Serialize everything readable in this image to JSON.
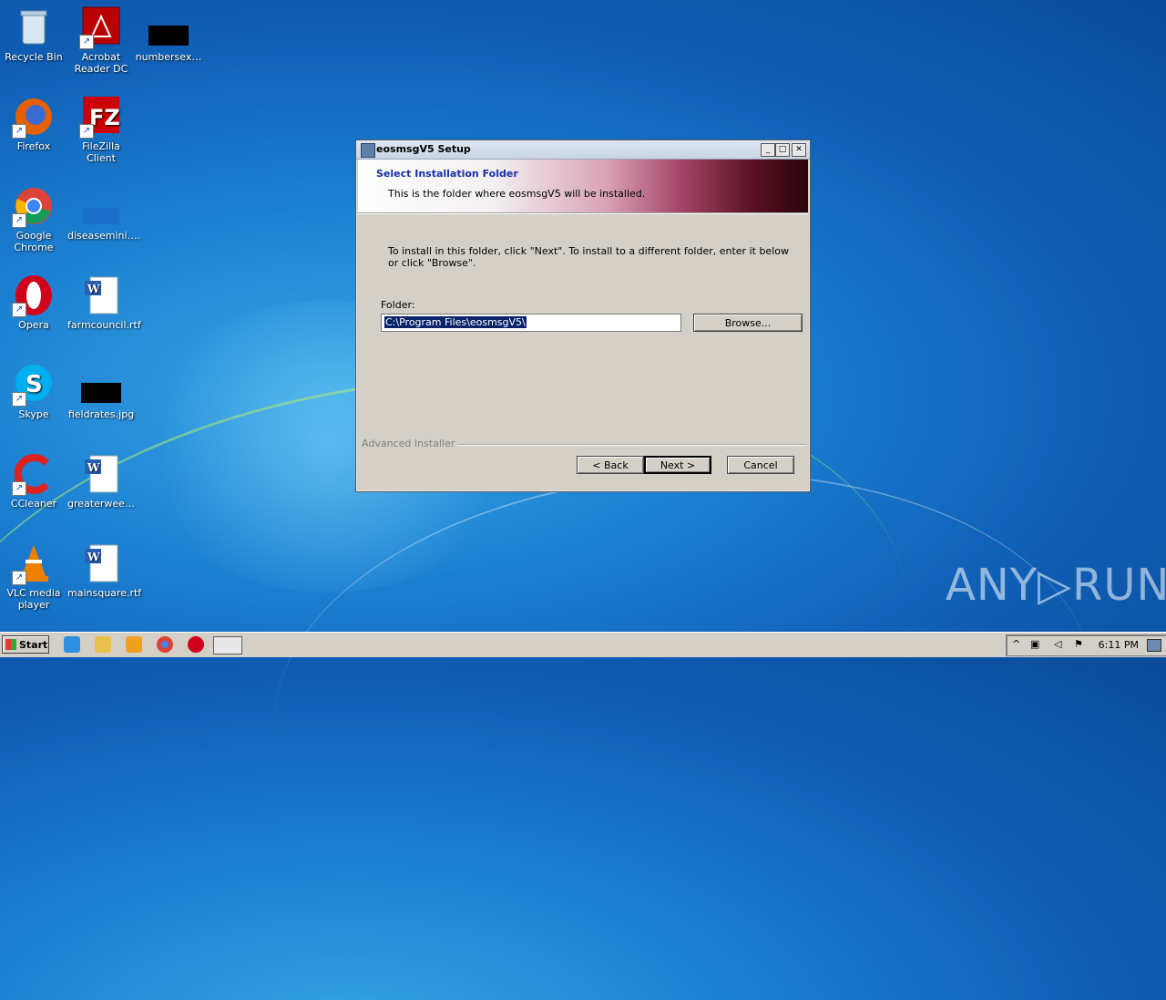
{
  "desktop": {
    "icons": [
      {
        "label": "Recycle Bin",
        "icon": "recycle-bin-icon"
      },
      {
        "label": "Acrobat Reader DC",
        "icon": "acrobat-icon"
      },
      {
        "label": "numbersex…",
        "icon": "file-icon"
      },
      {
        "label": "Firefox",
        "icon": "firefox-icon"
      },
      {
        "label": "FileZilla Client",
        "icon": "filezilla-icon"
      },
      {
        "label": "Google Chrome",
        "icon": "chrome-icon"
      },
      {
        "label": "diseasemini….",
        "icon": "file-icon"
      },
      {
        "label": "Opera",
        "icon": "opera-icon"
      },
      {
        "label": "farmcouncil.rtf",
        "icon": "word-document-icon"
      },
      {
        "label": "Skype",
        "icon": "skype-icon"
      },
      {
        "label": "fieldrates.jpg",
        "icon": "image-file-icon"
      },
      {
        "label": "CCleaner",
        "icon": "ccleaner-icon"
      },
      {
        "label": "greaterwee…",
        "icon": "word-document-icon"
      },
      {
        "label": "VLC media player",
        "icon": "vlc-icon"
      },
      {
        "label": "mainsquare.rtf",
        "icon": "word-document-icon"
      }
    ]
  },
  "dialog": {
    "title": "eosmsgV5 Setup",
    "heading": "Select Installation Folder",
    "subheading": "This is the folder where eosmsgV5 will be installed.",
    "instructions": "To install in this folder, click \"Next\". To install to a different folder, enter it below or click \"Browse\".",
    "folder_label": "Folder:",
    "folder_value": "C:\\Program Files\\eosmsgV5\\",
    "browse_label": "Browse...",
    "footer_brand": "Advanced Installer",
    "back_label": "< Back",
    "next_label": "Next >",
    "cancel_label": "Cancel",
    "minimize": "_",
    "maximize": "□",
    "close": "✕"
  },
  "taskbar": {
    "start_label": "Start",
    "clock": "6:11 PM"
  },
  "watermark": "ANY▷RUN"
}
